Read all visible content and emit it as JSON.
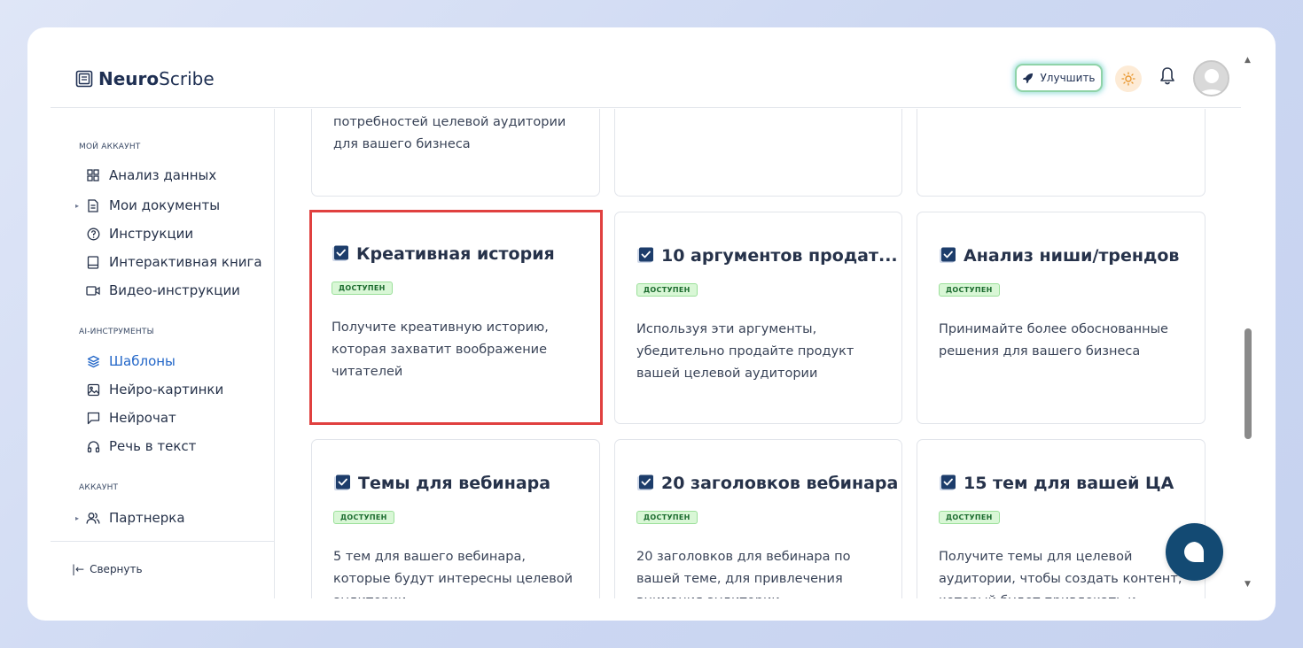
{
  "app": {
    "logo_bold": "Neuro",
    "logo_light": "Scribe"
  },
  "header": {
    "upgrade_label": "Улучшить"
  },
  "sidebar": {
    "sections": [
      {
        "title": "МОЙ АККАУНТ",
        "items": [
          {
            "label": "Анализ данных",
            "icon": "grid-icon",
            "caret": false
          },
          {
            "label": "Мои документы",
            "icon": "document-icon",
            "caret": true
          },
          {
            "label": "Инструкции",
            "icon": "help-circle-icon",
            "caret": false
          },
          {
            "label": "Интерактивная книга",
            "icon": "book-icon",
            "caret": false
          },
          {
            "label": "Видео-инструкции",
            "icon": "video-icon",
            "caret": false
          }
        ]
      },
      {
        "title": "AI-ИНСТРУМЕНТЫ",
        "items": [
          {
            "label": "Шаблоны",
            "icon": "layers-icon",
            "caret": false,
            "active": true
          },
          {
            "label": "Нейро-картинки",
            "icon": "image-icon",
            "caret": false
          },
          {
            "label": "Нейрочат",
            "icon": "chat-icon",
            "caret": false
          },
          {
            "label": "Речь в текст",
            "icon": "headphones-icon",
            "caret": false
          }
        ]
      },
      {
        "title": "АККАУНТ",
        "items": [
          {
            "label": "Партнерка",
            "icon": "users-icon",
            "caret": true
          }
        ]
      }
    ],
    "collapse_label": "Свернуть"
  },
  "cards_top_partial": {
    "desc": "потребностей целевой аудитории для вашего бизнеса"
  },
  "cards": [
    {
      "title": "Креативная история",
      "badge": "ДОСТУПЕН",
      "desc": "Получите креативную историю, которая захватит воображение читателей",
      "selected": true
    },
    {
      "title": "10 аргументов продат...",
      "badge": "ДОСТУПЕН",
      "desc": "Используя эти аргументы, убедительно продайте продукт вашей целевой аудитории"
    },
    {
      "title": "Анализ ниши/трендов",
      "badge": "ДОСТУПЕН",
      "desc": "Принимайте более обоснованные решения для вашего бизнеса"
    },
    {
      "title": "Темы для вебинара",
      "badge": "ДОСТУПЕН",
      "desc": "5 тем для вашего вебинара, которые будут интересны целевой аудитории"
    },
    {
      "title": "20 заголовков вебинара",
      "badge": "ДОСТУПЕН",
      "desc": "20 заголовков для вебинара по вашей теме, для привлечения внимания аудитории"
    },
    {
      "title": "15 тем для вашей ЦА",
      "badge": "ДОСТУПЕН",
      "desc": "Получите темы для целевой аудитории, чтобы создать контент, который будет привлекать и"
    }
  ],
  "colors": {
    "accent": "#2266c8",
    "navy": "#134a73",
    "selection": "#e0403f",
    "badge_bg": "#d9f7d6"
  }
}
